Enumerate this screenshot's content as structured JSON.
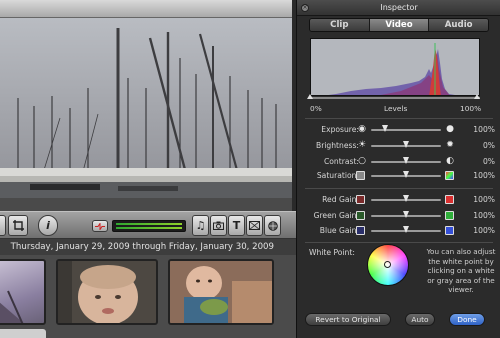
{
  "inspector": {
    "title": "Inspector",
    "tabs": [
      {
        "label": "Clip",
        "active": false
      },
      {
        "label": "Video",
        "active": true
      },
      {
        "label": "Audio",
        "active": false
      }
    ],
    "levels": {
      "min_label": "0%",
      "label": "Levels",
      "max_label": "100%",
      "low": 0,
      "high": 100
    },
    "sliders": [
      {
        "label": "Exposure:",
        "left_icon": "exposure-low-icon",
        "right_icon": "exposure-high-icon",
        "value": "100%",
        "level": 0.2
      },
      {
        "label": "Brightness:",
        "left_icon": "brightness-low-icon",
        "right_icon": "brightness-high-icon",
        "value": "0%",
        "level": 0.5
      },
      {
        "label": "Contrast:",
        "left_icon": "contrast-low-icon",
        "right_icon": "contrast-high-icon",
        "value": "0%",
        "level": 0.5
      },
      {
        "label": "Saturation:",
        "left_icon": "saturation-low-icon",
        "right_icon": "saturation-high-icon",
        "value": "100%",
        "level": 0.5
      },
      {
        "label": "Red Gain:",
        "left_icon": "red-swatch",
        "right_icon": "red-swatch",
        "value": "100%",
        "level": 0.5
      },
      {
        "label": "Green Gain:",
        "left_icon": "green-swatch",
        "right_icon": "green-swatch",
        "value": "100%",
        "level": 0.5
      },
      {
        "label": "Blue Gain:",
        "left_icon": "blue-swatch",
        "right_icon": "blue-swatch",
        "value": "100%",
        "level": 0.5
      }
    ],
    "white_point": {
      "label": "White Point:",
      "help": "You can also adjust the white point by clicking on a white or gray area of the viewer."
    },
    "buttons": {
      "revert": "Revert to Original",
      "auto": "Auto",
      "done": "Done"
    },
    "colors": {
      "accent": "#3b6fd0",
      "red": "#d93030",
      "green": "#2fae3a",
      "blue": "#3550d8"
    }
  },
  "event_browser": {
    "date_range": "Thursday, January 29, 2009 through Friday, January 30, 2009"
  },
  "toolbar": {
    "icons": [
      "crop-icon",
      "info-icon",
      "audio-meter",
      "music-icon",
      "camera-icon",
      "title-icon",
      "transition-icon",
      "globe-icon"
    ],
    "info_glyph": "i",
    "title_glyph": "T"
  }
}
